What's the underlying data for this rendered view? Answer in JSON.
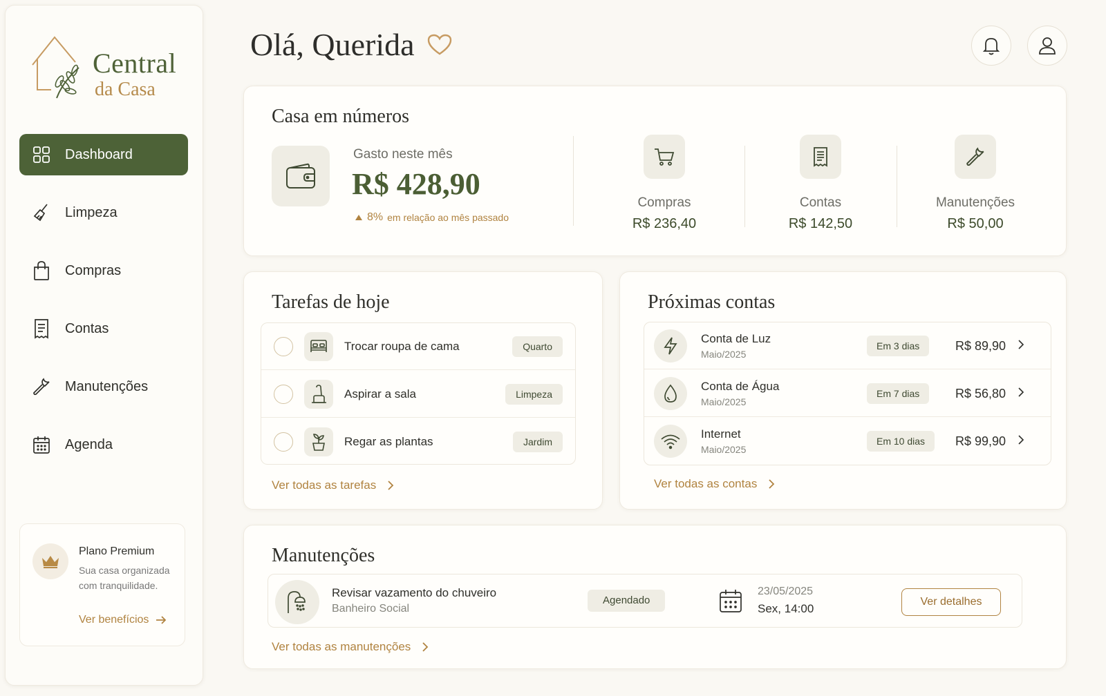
{
  "brand": {
    "name_line1": "Central",
    "name_line2": "da Casa",
    "primary_color": "#4d6237",
    "accent_color": "#b08340"
  },
  "sidebar": {
    "items": [
      {
        "label": "Dashboard",
        "icon": "grid-icon",
        "active": true
      },
      {
        "label": "Limpeza",
        "icon": "broom-icon",
        "active": false
      },
      {
        "label": "Compras",
        "icon": "shopping-bag-icon",
        "active": false
      },
      {
        "label": "Contas",
        "icon": "receipt-icon",
        "active": false
      },
      {
        "label": "Manutenções",
        "icon": "wrench-icon",
        "active": false
      },
      {
        "label": "Agenda",
        "icon": "calendar-icon",
        "active": false
      }
    ],
    "premium": {
      "title": "Plano Premium",
      "description": "Sua casa organizada com tranquilidade.",
      "link": "Ver benefícios"
    }
  },
  "header": {
    "greeting": "Olá, Querida"
  },
  "numbers": {
    "title": "Casa em números",
    "spent_label": "Gasto neste mês",
    "spent_value": "R$ 428,90",
    "change_pct": "8%",
    "change_text": "em relação ao mês passado",
    "stats": [
      {
        "label": "Compras",
        "value": "R$ 236,40",
        "icon": "cart-icon"
      },
      {
        "label": "Contas",
        "value": "R$ 142,50",
        "icon": "receipt-icon"
      },
      {
        "label": "Manutenções",
        "value": "R$ 50,00",
        "icon": "wrench-icon"
      }
    ]
  },
  "tasks": {
    "title": "Tarefas de hoje",
    "items": [
      {
        "label": "Trocar roupa de cama",
        "tag": "Quarto",
        "icon": "bed-icon"
      },
      {
        "label": "Aspirar a sala",
        "tag": "Limpeza",
        "icon": "vacuum-icon"
      },
      {
        "label": "Regar as plantas",
        "tag": "Jardim",
        "icon": "plant-icon"
      }
    ],
    "link": "Ver todas as tarefas"
  },
  "bills": {
    "title": "Próximas contas",
    "items": [
      {
        "name": "Conta de Luz",
        "period": "Maio/2025",
        "due": "Em 3 dias",
        "value": "R$ 89,90",
        "icon": "lightning-icon"
      },
      {
        "name": "Conta de Água",
        "period": "Maio/2025",
        "due": "Em 7 dias",
        "value": "R$ 56,80",
        "icon": "water-drop-icon"
      },
      {
        "name": "Internet",
        "period": "Maio/2025",
        "due": "Em 10 dias",
        "value": "R$ 99,90",
        "icon": "wifi-icon"
      }
    ],
    "link": "Ver todas as contas"
  },
  "maintenance": {
    "title": "Manutenções",
    "item": {
      "title": "Revisar vazamento do chuveiro",
      "location": "Banheiro Social",
      "status": "Agendado",
      "date": "23/05/2025",
      "time": "Sex, 14:00",
      "button": "Ver detalhes",
      "icon": "shower-icon"
    },
    "link": "Ver todas as manutenções"
  }
}
